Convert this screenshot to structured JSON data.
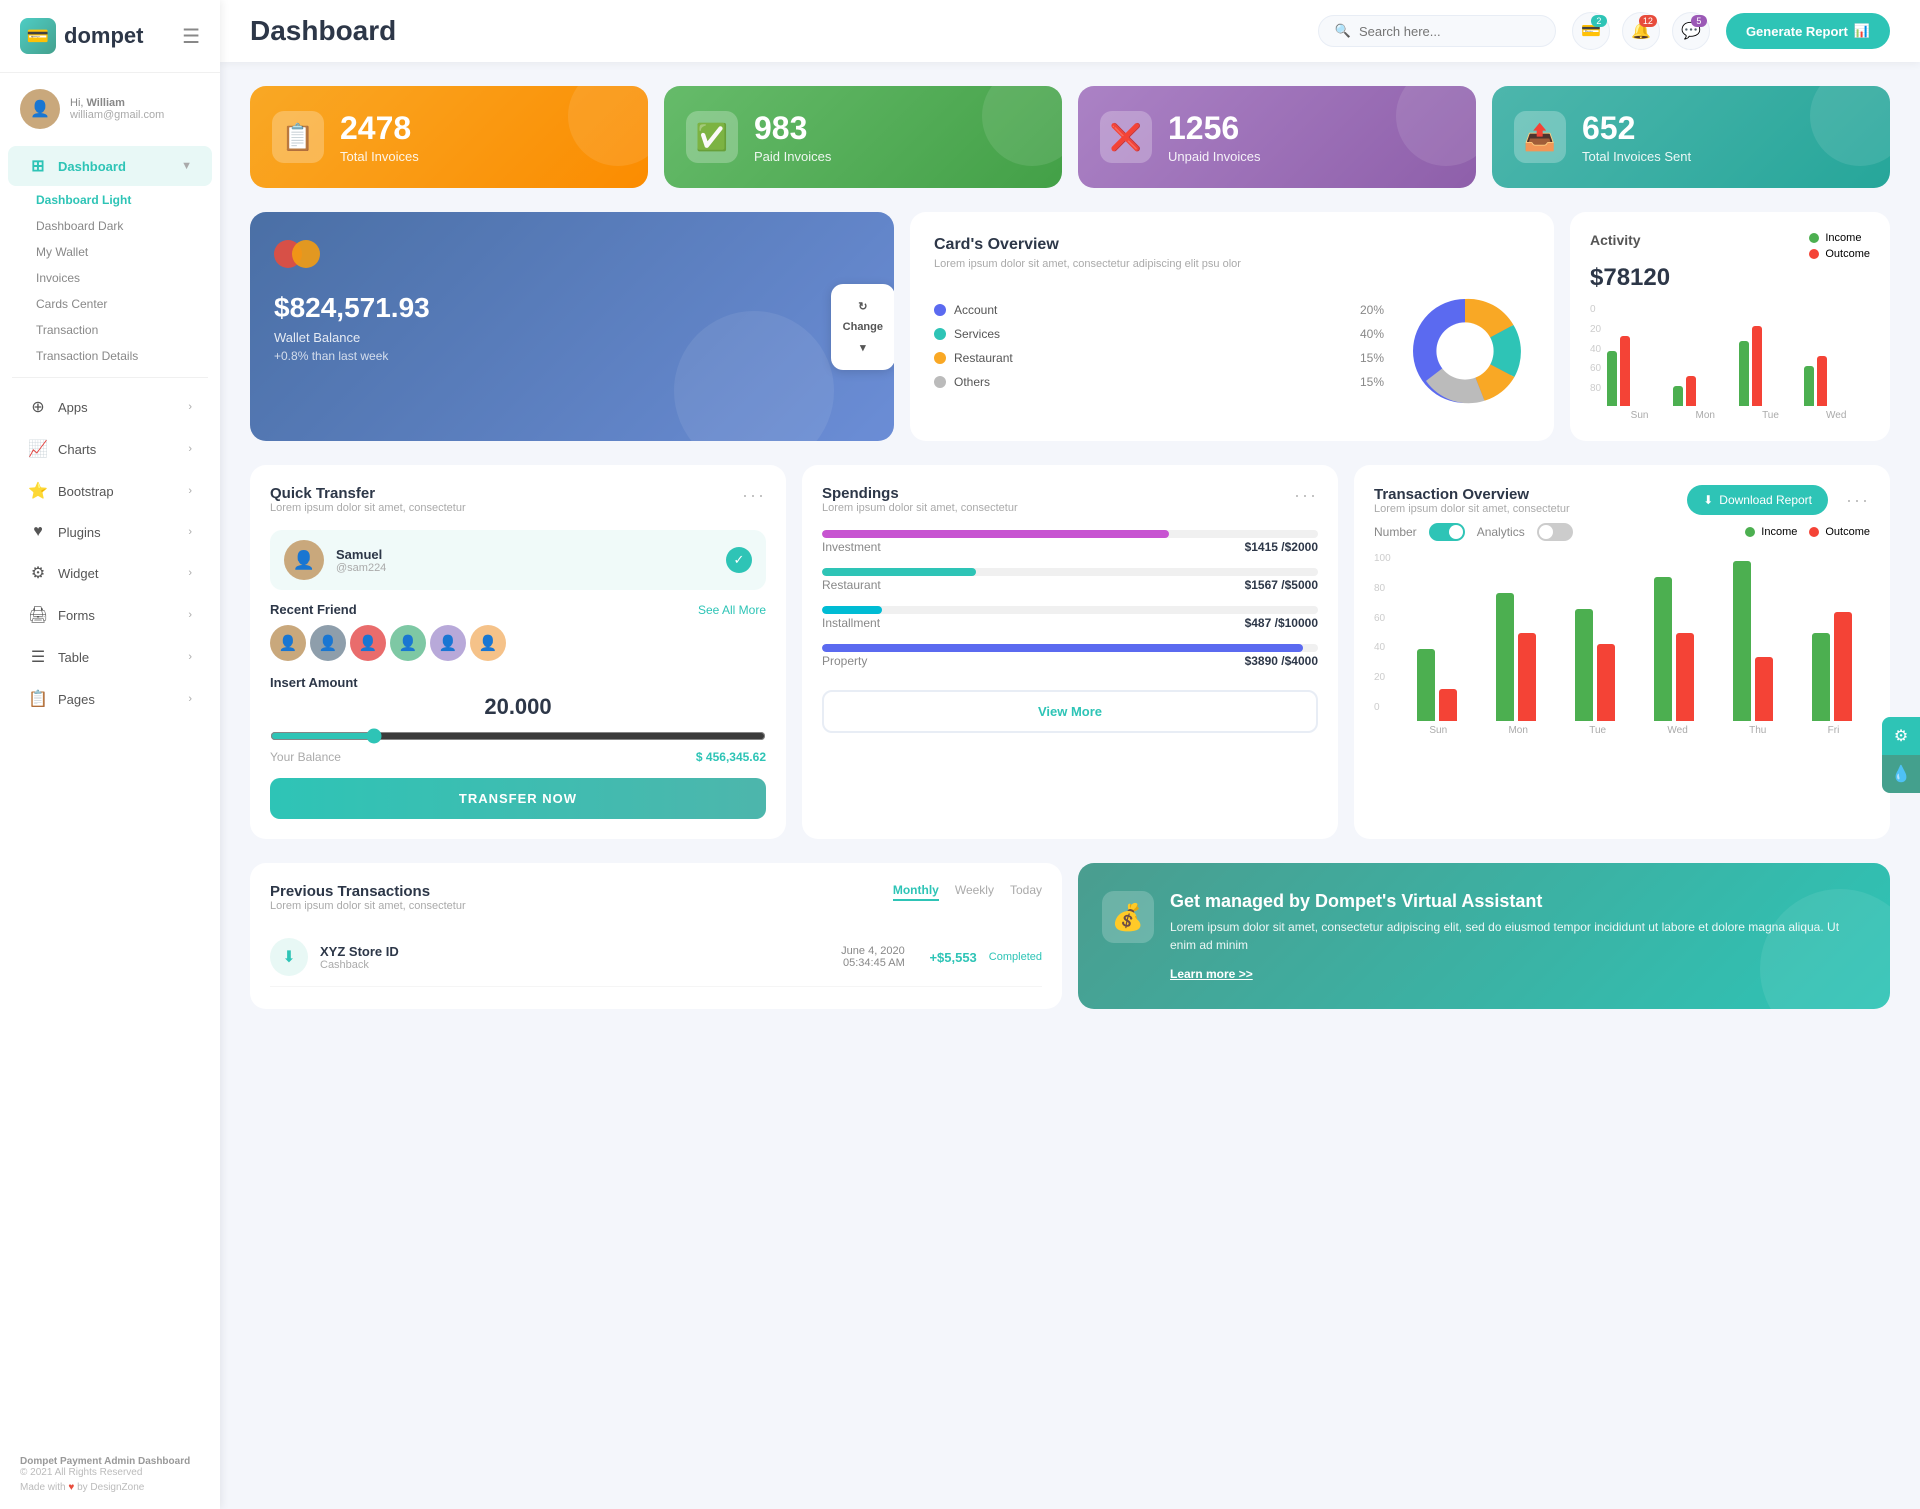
{
  "sidebar": {
    "logo": "dompet",
    "logo_icon": "💳",
    "user": {
      "hi": "Hi,",
      "name": "William",
      "email": "william@gmail.com"
    },
    "nav": [
      {
        "id": "dashboard",
        "label": "Dashboard",
        "icon": "⊞",
        "active": true,
        "has_arrow": true,
        "badge": ""
      },
      {
        "id": "apps",
        "label": "Apps",
        "icon": "⊕",
        "active": false,
        "has_arrow": true,
        "badge": ""
      },
      {
        "id": "charts",
        "label": "Charts",
        "icon": "📈",
        "active": false,
        "has_arrow": true,
        "badge": ""
      },
      {
        "id": "bootstrap",
        "label": "Bootstrap",
        "icon": "⭐",
        "active": false,
        "has_arrow": true,
        "badge": ""
      },
      {
        "id": "plugins",
        "label": "Plugins",
        "icon": "♥",
        "active": false,
        "has_arrow": true,
        "badge": ""
      },
      {
        "id": "widget",
        "label": "Widget",
        "icon": "⚙",
        "active": false,
        "has_arrow": true,
        "badge": ""
      },
      {
        "id": "forms",
        "label": "Forms",
        "icon": "🖨",
        "active": false,
        "has_arrow": true,
        "badge": ""
      },
      {
        "id": "table",
        "label": "Table",
        "icon": "☰",
        "active": false,
        "has_arrow": true,
        "badge": ""
      },
      {
        "id": "pages",
        "label": "Pages",
        "icon": "📋",
        "active": false,
        "has_arrow": true,
        "badge": ""
      }
    ],
    "sub_nav": [
      {
        "label": "Dashboard Light",
        "active": true
      },
      {
        "label": "Dashboard Dark",
        "active": false
      },
      {
        "label": "My Wallet",
        "active": false
      },
      {
        "label": "Invoices",
        "active": false
      },
      {
        "label": "Cards Center",
        "active": false
      },
      {
        "label": "Transaction",
        "active": false
      },
      {
        "label": "Transaction Details",
        "active": false
      }
    ],
    "footer": {
      "brand": "Dompet Payment Admin Dashboard",
      "year": "© 2021 All Rights Reserved",
      "made_with": "Made with ❤ by DesignZone"
    }
  },
  "header": {
    "title": "Dashboard",
    "search_placeholder": "Search here...",
    "badges": {
      "wallet": "2",
      "bell": "12",
      "chat": "5"
    },
    "generate_btn": "Generate Report"
  },
  "stats": [
    {
      "id": "total",
      "value": "2478",
      "label": "Total Invoices",
      "icon": "📋",
      "color": "orange"
    },
    {
      "id": "paid",
      "value": "983",
      "label": "Paid Invoices",
      "icon": "✅",
      "color": "green"
    },
    {
      "id": "unpaid",
      "value": "1256",
      "label": "Unpaid Invoices",
      "icon": "❌",
      "color": "purple"
    },
    {
      "id": "sent",
      "value": "652",
      "label": "Total Invoices Sent",
      "icon": "📤",
      "color": "teal"
    }
  ],
  "wallet": {
    "balance": "$824,571.93",
    "label": "Wallet Balance",
    "change": "+0.8% than last week",
    "change_btn": "Change"
  },
  "card_overview": {
    "title": "Card's Overview",
    "subtitle": "Lorem ipsum dolor sit amet, consectetur adipiscing elit psu olor",
    "items": [
      {
        "label": "Account",
        "pct": "20%",
        "color": "#5b6af0"
      },
      {
        "label": "Services",
        "pct": "40%",
        "color": "#2ec4b6"
      },
      {
        "label": "Restaurant",
        "pct": "15%",
        "color": "#f9a825"
      },
      {
        "label": "Others",
        "pct": "15%",
        "color": "#bbb"
      }
    ]
  },
  "activity": {
    "title": "Activity",
    "amount": "$78120",
    "income_label": "Income",
    "outcome_label": "Outcome",
    "y_labels": [
      "80",
      "60",
      "40",
      "20",
      "0"
    ],
    "x_labels": [
      "Sun",
      "Mon",
      "Tue",
      "Wed"
    ],
    "bars": [
      {
        "green": 55,
        "red": 70
      },
      {
        "green": 20,
        "red": 30
      },
      {
        "green": 65,
        "red": 80
      },
      {
        "green": 40,
        "red": 50
      }
    ]
  },
  "quick_transfer": {
    "title": "Quick Transfer",
    "subtitle": "Lorem ipsum dolor sit amet, consectetur",
    "contact": {
      "name": "Samuel",
      "handle": "@sam224",
      "avatar": "👤"
    },
    "recent_label": "Recent Friend",
    "see_all": "See All More",
    "insert_label": "Insert Amount",
    "amount": "20.000",
    "balance_label": "Your Balance",
    "balance_value": "$ 456,345.62",
    "transfer_btn": "TRANSFER NOW"
  },
  "spendings": {
    "title": "Spendings",
    "subtitle": "Lorem ipsum dolor sit amet, consectetur",
    "items": [
      {
        "label": "Investment",
        "amount": "$1415",
        "total": "$2000",
        "pct": 70,
        "color": "#c754d1"
      },
      {
        "label": "Restaurant",
        "amount": "$1567",
        "total": "$5000",
        "pct": 31,
        "color": "#2ec4b6"
      },
      {
        "label": "Installment",
        "amount": "$487",
        "total": "$10000",
        "pct": 12,
        "color": "#00bcd4"
      },
      {
        "label": "Property",
        "amount": "$3890",
        "total": "$4000",
        "pct": 97,
        "color": "#5b6af0"
      }
    ],
    "view_more": "View More"
  },
  "transaction_overview": {
    "title": "Transaction Overview",
    "subtitle": "Lorem ipsum dolor sit amet, consectetur",
    "download_btn": "Download Report",
    "number_label": "Number",
    "analytics_label": "Analytics",
    "income_label": "Income",
    "outcome_label": "Outcome",
    "y_labels": [
      "100",
      "80",
      "60",
      "40",
      "20",
      "0"
    ],
    "x_labels": [
      "Sun",
      "Mon",
      "Tue",
      "Wed",
      "Thu",
      "Fri"
    ],
    "bars": [
      {
        "green": 45,
        "red": 20
      },
      {
        "green": 80,
        "red": 55
      },
      {
        "green": 70,
        "red": 48
      },
      {
        "green": 90,
        "red": 55
      },
      {
        "green": 100,
        "red": 40
      },
      {
        "green": 55,
        "red": 68
      }
    ]
  },
  "prev_transactions": {
    "title": "Previous Transactions",
    "subtitle": "Lorem ipsum dolor sit amet, consectetur",
    "tabs": [
      "Monthly",
      "Weekly",
      "Today"
    ],
    "active_tab": "Monthly",
    "items": [
      {
        "name": "XYZ Store ID",
        "type": "Cashback",
        "date": "June 4, 2020",
        "time": "05:34:45 AM",
        "amount": "+$5,553",
        "status": "Completed",
        "icon": "⬇"
      }
    ]
  },
  "virtual_assistant": {
    "title": "Get managed by Dompet's Virtual Assistant",
    "text": "Lorem ipsum dolor sit amet, consectetur adipiscing elit, sed do eiusmod tempor incididunt ut labore et dolore magna aliqua. Ut enim ad minim",
    "link": "Learn more >>",
    "icon": "💰"
  }
}
